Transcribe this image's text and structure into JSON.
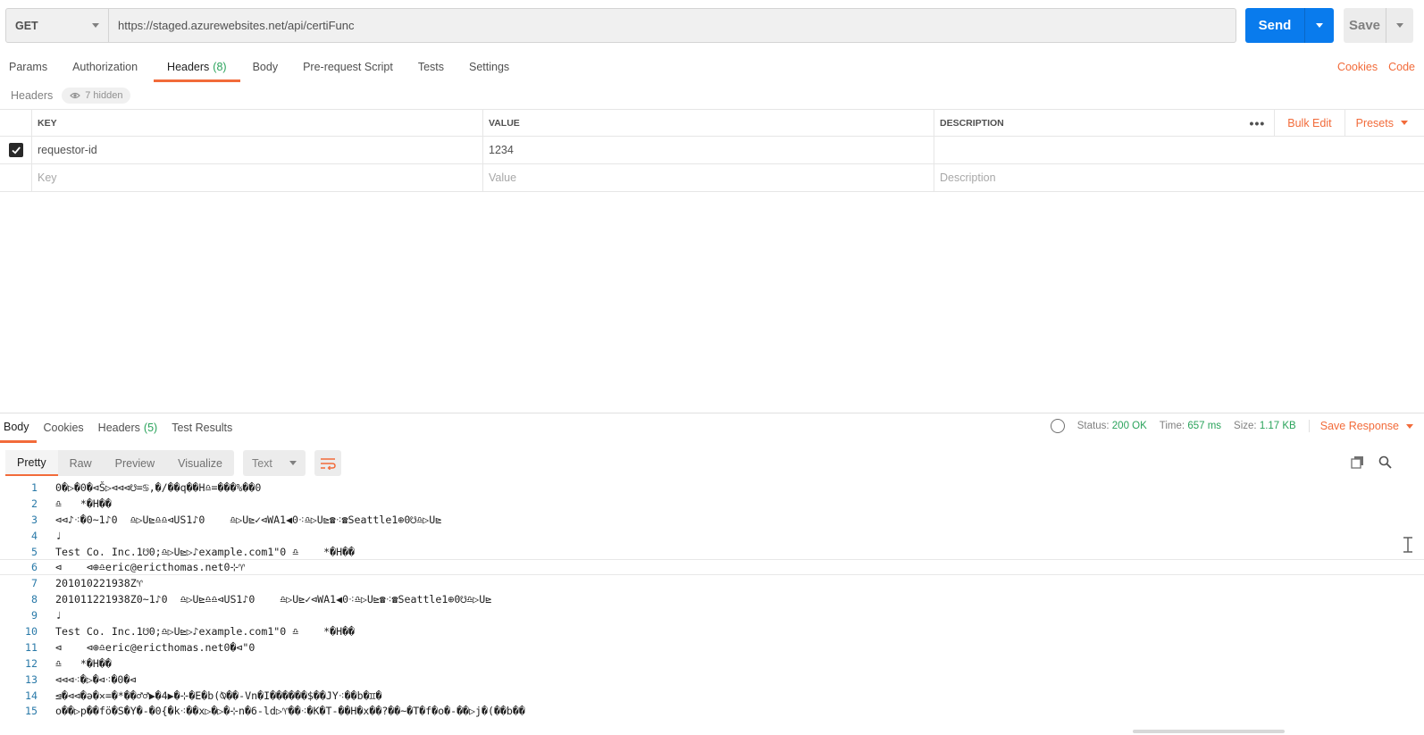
{
  "request": {
    "method": "GET",
    "url": "https://staged.azurewebsites.net/api/certiFunc",
    "send_label": "Send",
    "save_label": "Save"
  },
  "request_tabs": [
    {
      "label": "Params",
      "count": ""
    },
    {
      "label": "Authorization",
      "count": ""
    },
    {
      "label": "Headers",
      "count": "(8)"
    },
    {
      "label": "Body",
      "count": ""
    },
    {
      "label": "Pre-request Script",
      "count": ""
    },
    {
      "label": "Tests",
      "count": ""
    },
    {
      "label": "Settings",
      "count": ""
    }
  ],
  "right_links": {
    "cookies": "Cookies",
    "code": "Code"
  },
  "headers_section": {
    "label": "Headers",
    "hidden": "7 hidden"
  },
  "headers_table": {
    "columns": {
      "key": "KEY",
      "value": "VALUE",
      "description": "DESCRIPTION"
    },
    "more": "•••",
    "bulk_edit": "Bulk Edit",
    "presets": "Presets",
    "rows": [
      {
        "checked": true,
        "key": "requestor-id",
        "value": "1234",
        "description": ""
      }
    ],
    "placeholder": {
      "key": "Key",
      "value": "Value",
      "description": "Description"
    }
  },
  "response_tabs": [
    {
      "label": "Body",
      "count": ""
    },
    {
      "label": "Cookies",
      "count": ""
    },
    {
      "label": "Headers",
      "count": "(5)"
    },
    {
      "label": "Test Results",
      "count": ""
    }
  ],
  "response_status": {
    "status_label": "Status:",
    "status": "200 OK",
    "time_label": "Time:",
    "time": "657 ms",
    "size_label": "Size:",
    "size": "1.17 KB",
    "save_response": "Save Response"
  },
  "view_modes": [
    "Pretty",
    "Raw",
    "Preview",
    "Visualize"
  ],
  "format": "Text",
  "body_lines": [
    {
      "n": "1",
      "text": "0�▷�0�⊲Š▷⊲⊲⊲☋=♋,�/��q��H♎=���%��0"
    },
    {
      "n": "2",
      "text": "♎   *�H��"
    },
    {
      "n": "3",
      "text": "⊲⊲♪⁖�0~1♪0  ♎▷U⊵♎♎⊲US1♪0    ♎▷U⊵✓⊲WA1◀0⁖♎▷U⊵☎⁖☎Seattle1⊕0☋♎▷U⊵"
    },
    {
      "n": "4",
      "text": "♩"
    },
    {
      "n": "5",
      "text": "Test Co. Inc.1☋0;♎▷U⊵▷♪example.com1\"0 ♎    *�H��"
    },
    {
      "n": "6",
      "text": "⊲    ⊲⊕♎eric@ericthomas.net0⊹♈"
    },
    {
      "n": "7",
      "text": "201010221938Z♈"
    },
    {
      "n": "8",
      "text": "201011221938Z0~1♪0  ♎▷U⊵♎♎⊲US1♪0    ♎▷U⊵✓⊲WA1◀0⁖♎▷U⊵☎⁖☎Seattle1⊕0☋♎▷U⊵"
    },
    {
      "n": "9",
      "text": "♩"
    },
    {
      "n": "10",
      "text": "Test Co. Inc.1☋0;♎▷U⊵▷♪example.com1\"0 ♎    *�H��"
    },
    {
      "n": "11",
      "text": "⊲    ⊲⊕♎eric@ericthomas.net0�⊲\"0"
    },
    {
      "n": "12",
      "text": "♎   *�H��"
    },
    {
      "n": "13",
      "text": "⊲⊲⊲⁖�▷�⊲⁖�0�⊲"
    },
    {
      "n": "14",
      "text": "⊴�⊲⊲�ə�✕=�*��♂♂▶�4▶�⊹�E�b(⍉��-Vn�I������$��JY⁖��b�♊�"
    },
    {
      "n": "15",
      "text": "o��▷p��fö�S�Y�-�0{�k⁖��x▷�▷�⊹n�6-ld▷♈��⁖�K�T-��H�x��?��~�T�f�o�-��▷j�(��b��"
    }
  ]
}
